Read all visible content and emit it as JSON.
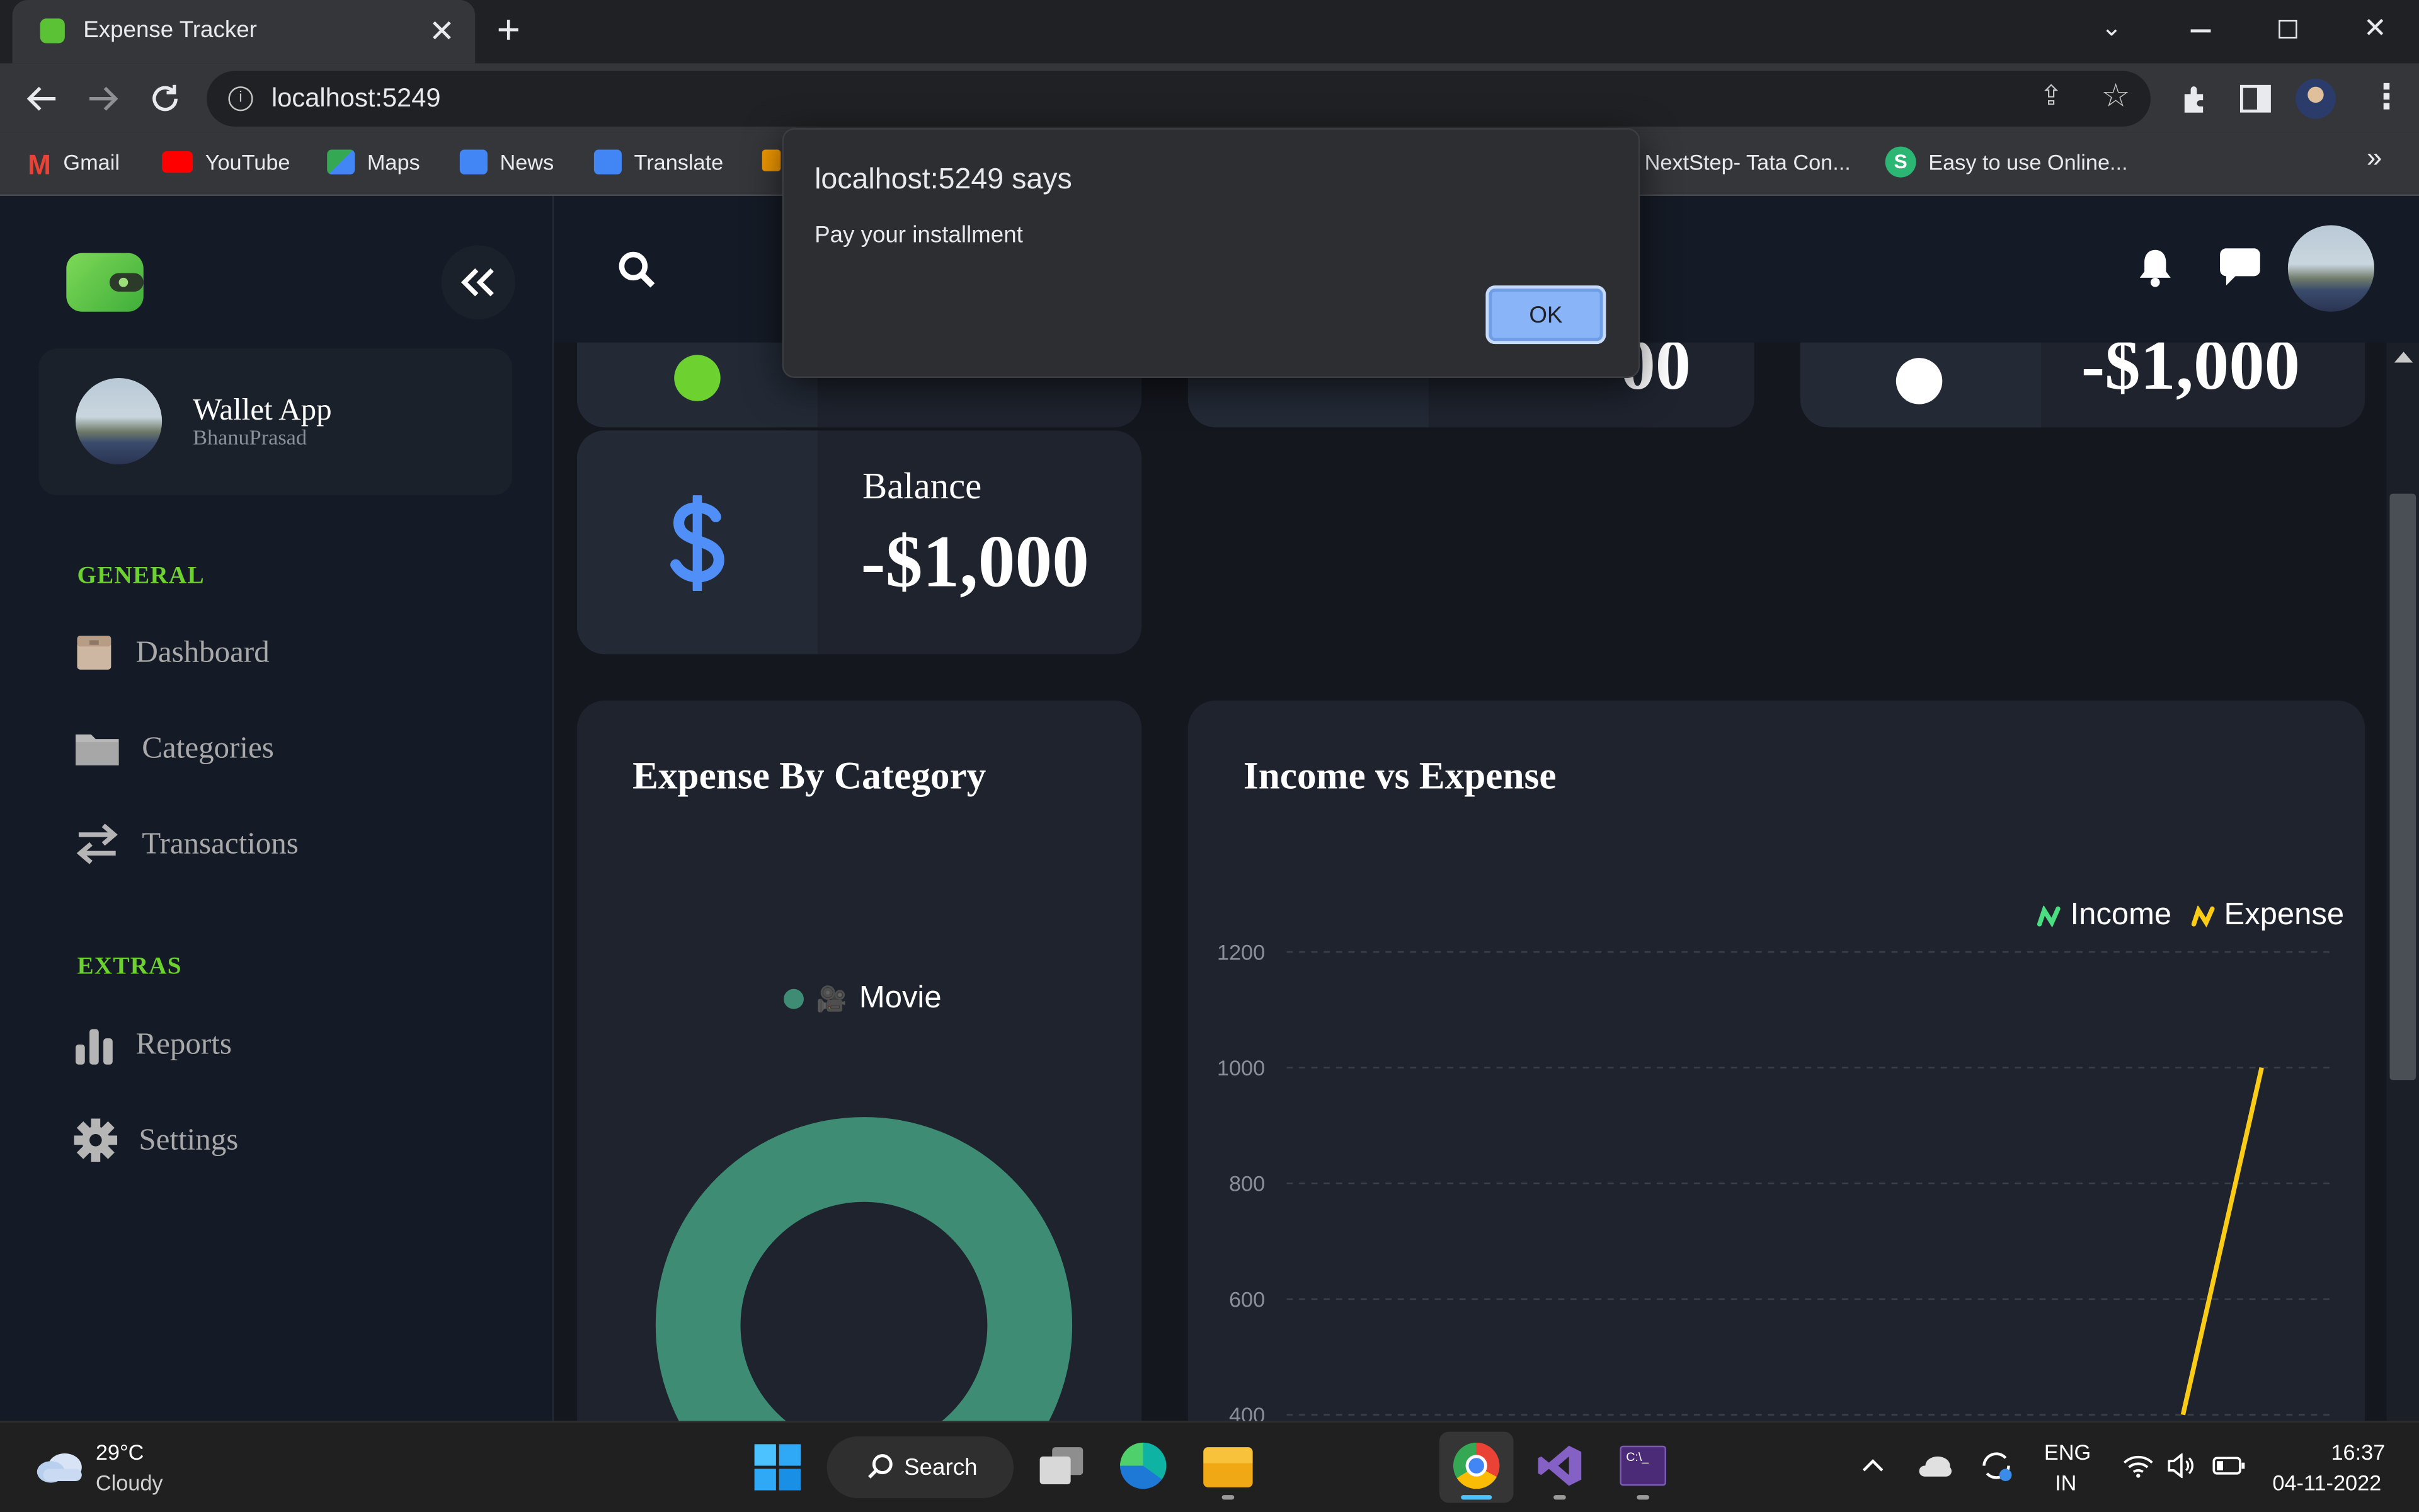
{
  "browser": {
    "tab_title": "Expense Tracker",
    "address": "localhost:5249",
    "bookmarks": [
      {
        "label": "Gmail",
        "color": "#ea4335"
      },
      {
        "label": "YouTube",
        "color": "#ff0000"
      },
      {
        "label": "Maps",
        "color": "#34a853"
      },
      {
        "label": "News",
        "color": "#4285f4"
      },
      {
        "label": "Translate",
        "color": "#4285f4"
      },
      {
        "label": "NextStep- Tata Con...",
        "color": "#2c6fbf"
      },
      {
        "label": "Easy to use Online...",
        "color": "#2bb673"
      }
    ],
    "more_bookmarks": "»"
  },
  "dialog": {
    "title": "localhost:5249 says",
    "message": "Pay your installment",
    "ok_label": "OK"
  },
  "sidebar": {
    "profile_name": "Wallet App",
    "profile_user": "BhanuPrasad",
    "general_label": "GENERAL",
    "extras_label": "EXTRAS",
    "items": [
      {
        "label": "Dashboard",
        "icon": "box-icon"
      },
      {
        "label": "Categories",
        "icon": "folder-icon"
      },
      {
        "label": "Transactions",
        "icon": "exchange-icon"
      },
      {
        "label": "Reports",
        "icon": "bar-chart-icon"
      },
      {
        "label": "Settings",
        "icon": "gear-icon"
      }
    ]
  },
  "cards": {
    "card2_value_partial": "00",
    "card3_value_partial": "-$1,000",
    "balance_label": "Balance",
    "balance_value": "-$1,000"
  },
  "expense_chart": {
    "title": "Expense By Category",
    "legend_label": "Movie",
    "legend_icon": "🎥"
  },
  "income_chart": {
    "title": "Income vs Expense",
    "legend": [
      {
        "name": "Income",
        "color": "#4ade80"
      },
      {
        "name": "Expense",
        "color": "#facc15"
      }
    ]
  },
  "chart_data": [
    {
      "type": "pie",
      "title": "Expense By Category",
      "labels": [
        "Movie"
      ],
      "values": [
        1000
      ],
      "colors": [
        "#3e8c74"
      ]
    },
    {
      "type": "line",
      "title": "Income vs Expense",
      "y_ticks": [
        1200,
        1000,
        800,
        600,
        400
      ],
      "ylim": [
        400,
        1200
      ],
      "grid": true,
      "legend_position": "top-right",
      "series": [
        {
          "name": "Income",
          "color": "#4ade80",
          "points": []
        },
        {
          "name": "Expense",
          "color": "#facc15",
          "points": [
            [
              0,
              400
            ],
            [
              1,
              1000
            ]
          ]
        }
      ]
    }
  ],
  "taskbar": {
    "temperature": "29°C",
    "weather": "Cloudy",
    "search_label": "Search",
    "lang_top": "ENG",
    "lang_bottom": "IN",
    "time": "16:37",
    "date": "04-11-2022"
  }
}
